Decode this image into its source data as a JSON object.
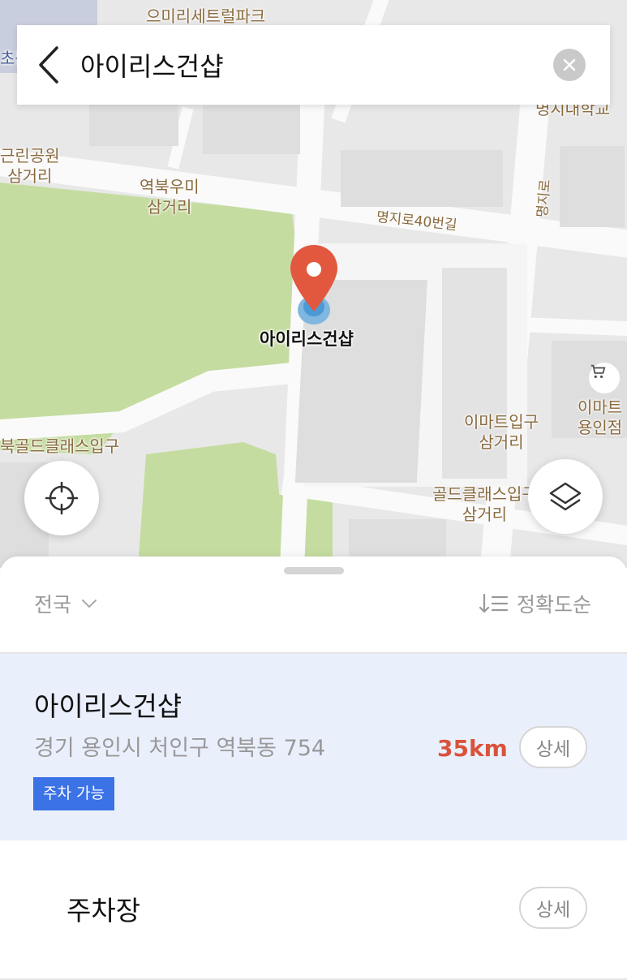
{
  "search": {
    "query": "아이리스건샵"
  },
  "map": {
    "marker_label": "아이리스건샵",
    "place_labels": [
      "으미리세트럴파크",
      "초등",
      "근린공원\n삼거리",
      "역북우미\n삼거리",
      "이마트입구\n삼거리",
      "이마트\n용인점",
      "북골드클래스입구",
      "골드클래스입구\n삼거리",
      "명지대학교"
    ],
    "road_labels": [
      "명지로40번길",
      "명지로"
    ]
  },
  "sheet": {
    "region_filter": "전국",
    "sort_label": "정확도순",
    "result": {
      "title": "아이리스건샵",
      "address": "경기 용인시 처인구 역북동 754",
      "distance": "35km",
      "detail_label": "상세",
      "badge": "주차 가능"
    },
    "sub_result": {
      "title": "주차장",
      "detail_label": "상세"
    }
  },
  "colors": {
    "accent": "#3b72e6",
    "distance": "#d9533b",
    "marker": "#e2583e",
    "park": "#c5dca0"
  },
  "icons": [
    "back-icon",
    "clear-icon",
    "locate-icon",
    "layers-icon",
    "chevron-down-icon",
    "sort-icon",
    "cart-icon",
    "map-pin-icon"
  ]
}
